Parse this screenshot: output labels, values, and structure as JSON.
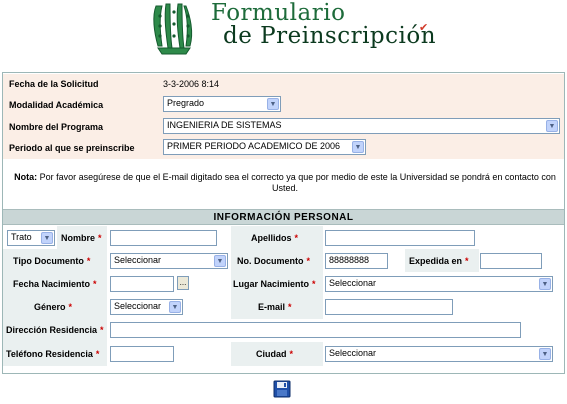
{
  "header": {
    "title_line1": "Formulario",
    "title_line2": "de Preinscripción"
  },
  "request": {
    "fecha_label": "Fecha de la Solicitud",
    "fecha_value": "3-3-2006 8:14",
    "modalidad_label": "Modalidad Académica",
    "modalidad_value": "Pregrado",
    "programa_label": "Nombre del Programa",
    "programa_value": "INGENIERIA DE SISTEMAS",
    "periodo_label": "Periodo al que se preinscribe",
    "periodo_value": "PRIMER PERIODO ACADEMICO DE 2006"
  },
  "note": {
    "prefix": "Nota:",
    "text": " Por favor asegúrese de que el E-mail digitado sea el correcto ya que por medio de este la Universidad se pondrá en contacto con Usted."
  },
  "personal": {
    "section_title": "INFORMACIÓN PERSONAL",
    "trato_value": "Trato",
    "nombre_label": "Nombre",
    "nombre_value": "",
    "apellidos_label": "Apellidos",
    "apellidos_value": "",
    "tipo_doc_label": "Tipo Documento",
    "tipo_doc_value": "Seleccionar",
    "no_doc_label": "No. Documento",
    "no_doc_value": "88888888",
    "expedida_label": "Expedida en",
    "expedida_value": "",
    "fecha_nac_label": "Fecha Nacimiento",
    "fecha_nac_value": "",
    "date_button": "...",
    "lugar_nac_label": "Lugar Nacimiento",
    "lugar_nac_value": "Seleccionar",
    "genero_label": "Género",
    "genero_value": "Seleccionar",
    "email_label": "E-mail",
    "email_value": "",
    "direccion_label": "Dirección Residencia",
    "direccion_value": "",
    "telefono_label": "Teléfono Residencia",
    "telefono_value": "",
    "ciudad_label": "Ciudad",
    "ciudad_value": "Seleccionar",
    "required_mark": "*"
  },
  "icons": {
    "save": "save-disk-icon",
    "logo": "university-logo"
  },
  "colors": {
    "peach_row": "#fbeee6",
    "section_header": "#c9d6d6",
    "required": "#cc0000",
    "brand_green": "#1d6b3a"
  }
}
